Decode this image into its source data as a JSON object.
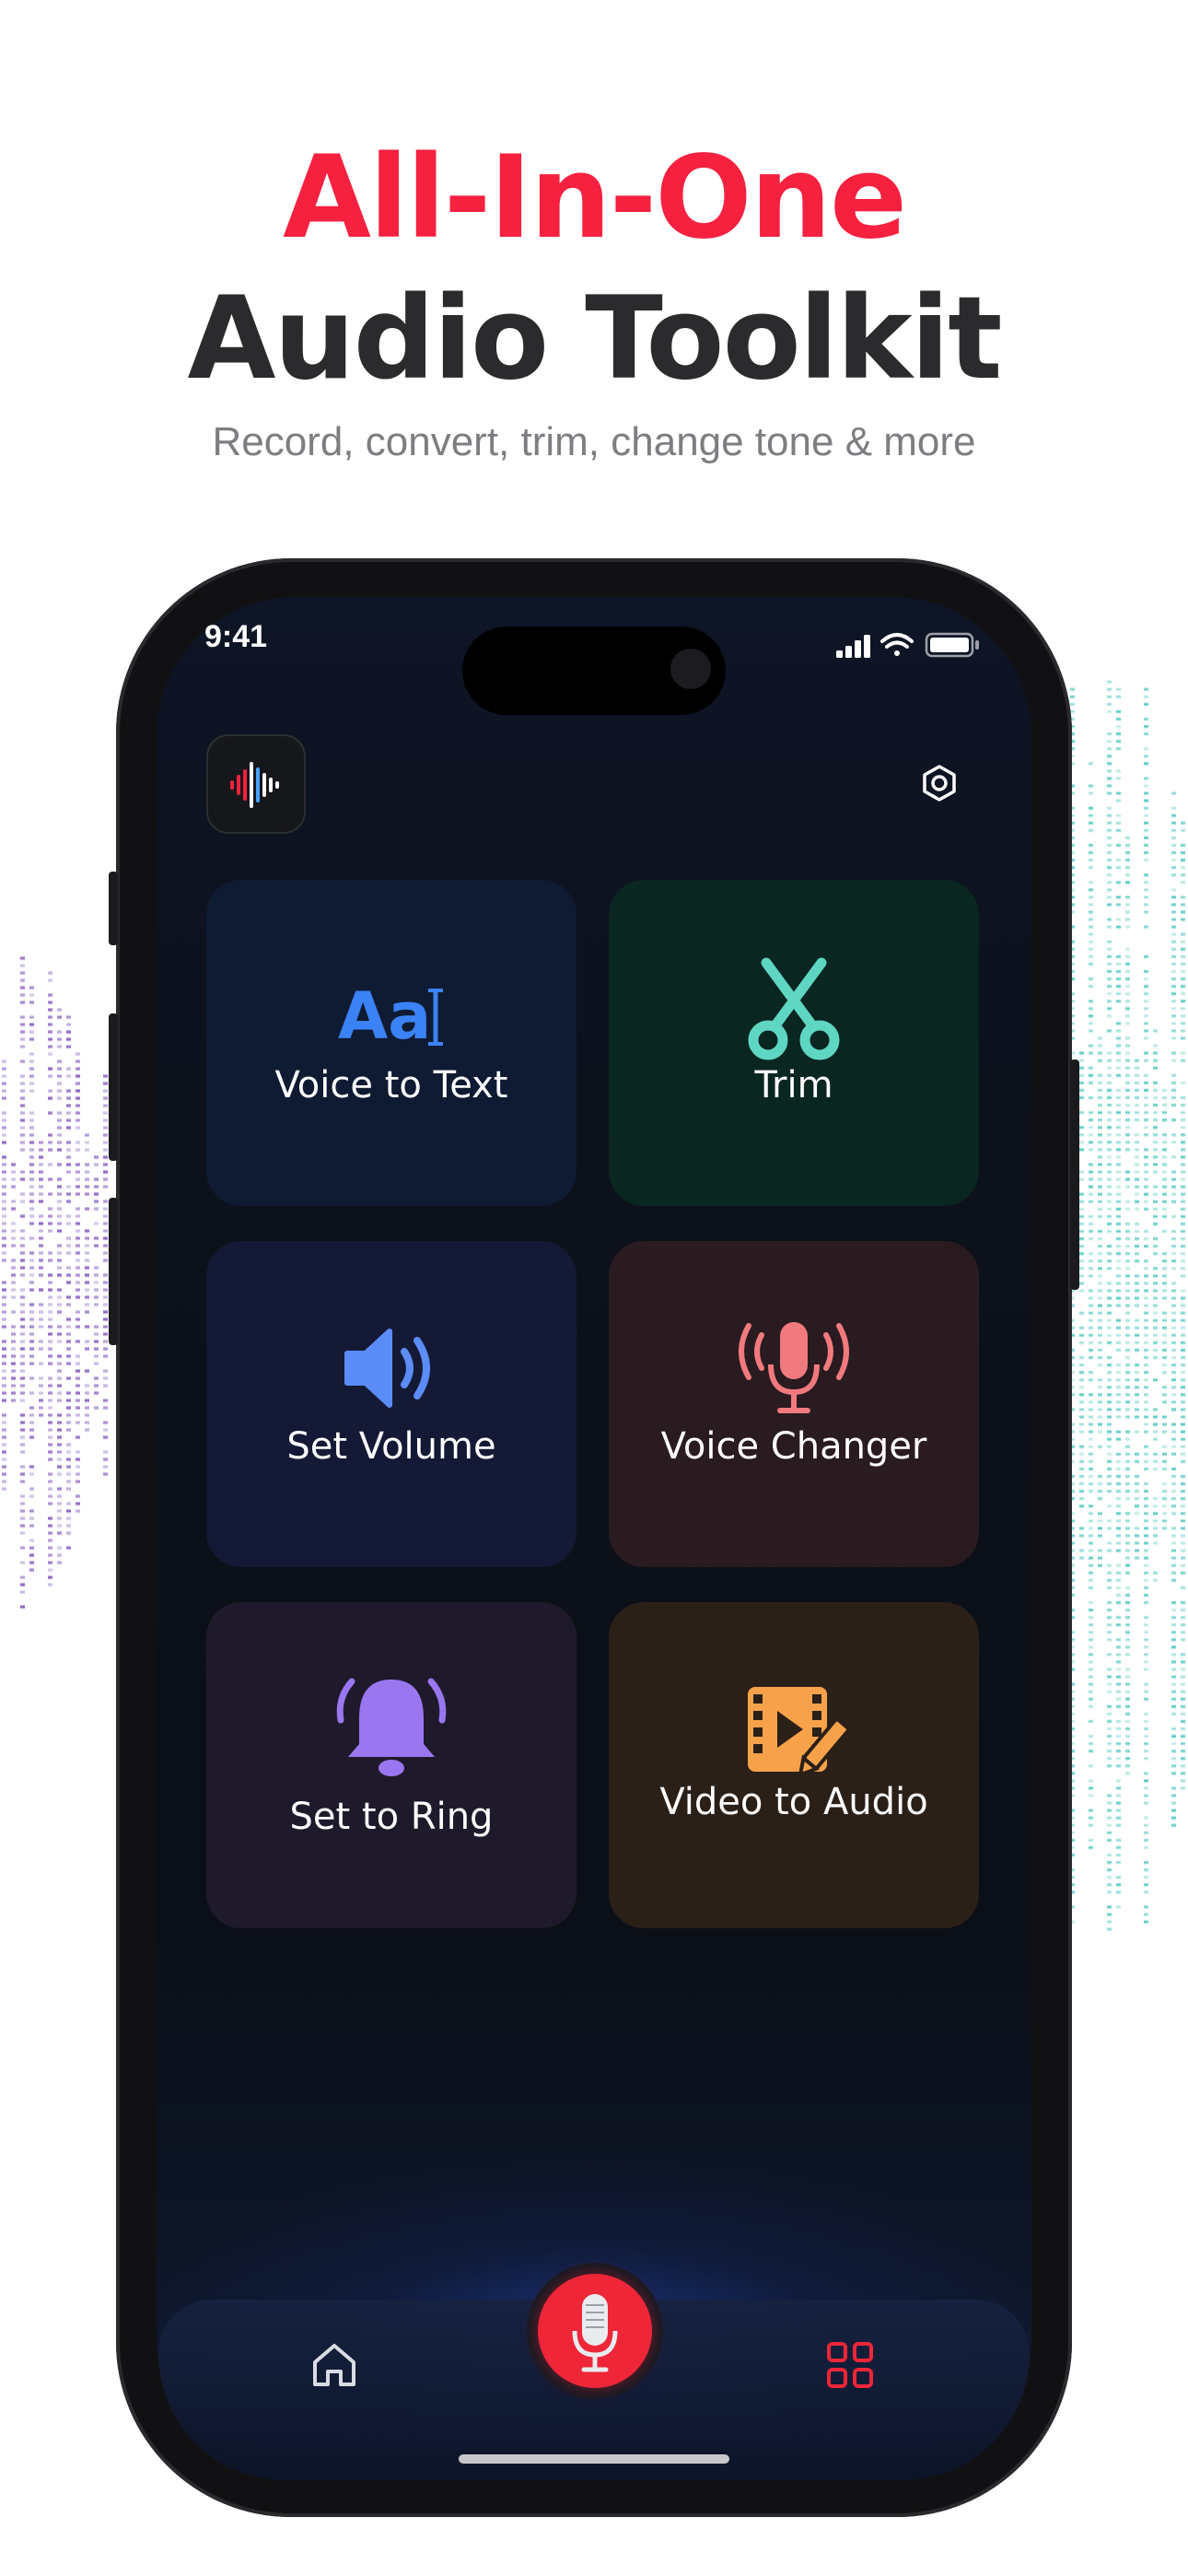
{
  "hero": {
    "line1": "All-In-One",
    "line2": "Audio Toolkit",
    "subtitle": "Record, convert, trim, change tone & more"
  },
  "status_bar": {
    "time": "9:41"
  },
  "tools": [
    {
      "label": "Voice to Text",
      "icon": "text-cursor-icon",
      "bg": "#0f1b33"
    },
    {
      "label": "Trim",
      "icon": "scissors-icon",
      "bg": "#0a2620"
    },
    {
      "label": "Set Volume",
      "icon": "speaker-icon",
      "bg": "#141a35"
    },
    {
      "label": "Voice Changer",
      "icon": "microphone-waves-icon",
      "bg": "#2a1b20"
    },
    {
      "label": "Set to Ring",
      "icon": "bell-icon",
      "bg": "#1f1a2b"
    },
    {
      "label": "Video to Audio",
      "icon": "film-edit-icon",
      "bg": "#2b2018"
    }
  ],
  "voice_to_text_glyph": "Aa",
  "colors": {
    "accent_red": "#f5213f",
    "record_red": "#ee2638",
    "trim_teal": "#5ed6c2",
    "volume_blue": "#5b8cf7",
    "voice_pink": "#f07a7e",
    "bell_purple": "#9a77f0",
    "video_orange": "#f7a24a"
  },
  "bottom_nav": {
    "items": [
      "home-icon",
      "microphone-icon",
      "grid-icon"
    ]
  }
}
